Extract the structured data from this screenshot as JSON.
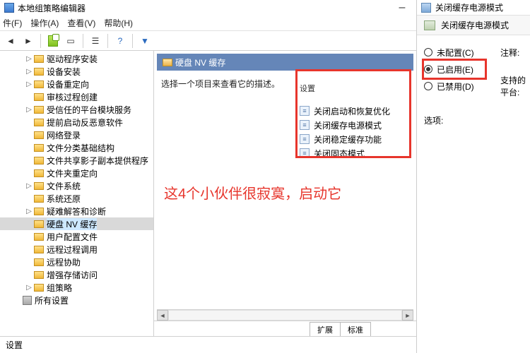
{
  "titlebar": {
    "title": "本地组策略编辑器"
  },
  "menu": {
    "file": "件(F)",
    "action": "操作(A)",
    "view": "查看(V)",
    "help": "帮助(H)"
  },
  "tree": {
    "items": [
      {
        "label": "驱动程序安装",
        "expandable": true
      },
      {
        "label": "设备安装",
        "expandable": true
      },
      {
        "label": "设备重定向",
        "expandable": true
      },
      {
        "label": "审核过程创建",
        "expandable": false
      },
      {
        "label": "受信任的平台模块服务",
        "expandable": true
      },
      {
        "label": "提前启动反恶意软件",
        "expandable": false
      },
      {
        "label": "网络登录",
        "expandable": false
      },
      {
        "label": "文件分类基础结构",
        "expandable": false
      },
      {
        "label": "文件共享影子副本提供程序",
        "expandable": false
      },
      {
        "label": "文件夹重定向",
        "expandable": false
      },
      {
        "label": "文件系统",
        "expandable": true
      },
      {
        "label": "系统还原",
        "expandable": false
      },
      {
        "label": "疑难解答和诊断",
        "expandable": true
      },
      {
        "label": "硬盘 NV 缓存",
        "expandable": false,
        "selected": true
      },
      {
        "label": "用户配置文件",
        "expandable": false
      },
      {
        "label": "远程过程调用",
        "expandable": false
      },
      {
        "label": "远程协助",
        "expandable": false
      },
      {
        "label": "增强存储访问",
        "expandable": false
      },
      {
        "label": "组策略",
        "expandable": true
      }
    ],
    "all_settings": "所有设置"
  },
  "main": {
    "header": "硬盘 NV 缓存",
    "instruction": "选择一个项目来查看它的描述。",
    "small_label": "设置",
    "items": [
      "关闭启动和恢复优化",
      "关闭缓存电源模式",
      "关闭稳定缓存功能",
      "关闭固态模式"
    ],
    "annotation": "这4个小伙伴很寂寞，启动它"
  },
  "tabs": {
    "extended": "扩展",
    "standard": "标准"
  },
  "status": "设置",
  "right": {
    "title": "关闭缓存电源模式",
    "subtitle": "关闭缓存电源模式",
    "comment_label": "注释:",
    "platform_label": "支持的平台:",
    "options_label": "选项:",
    "radio_unconfigured": "未配置(C)",
    "radio_enabled": "已启用(E)",
    "radio_disabled": "已禁用(D)"
  }
}
